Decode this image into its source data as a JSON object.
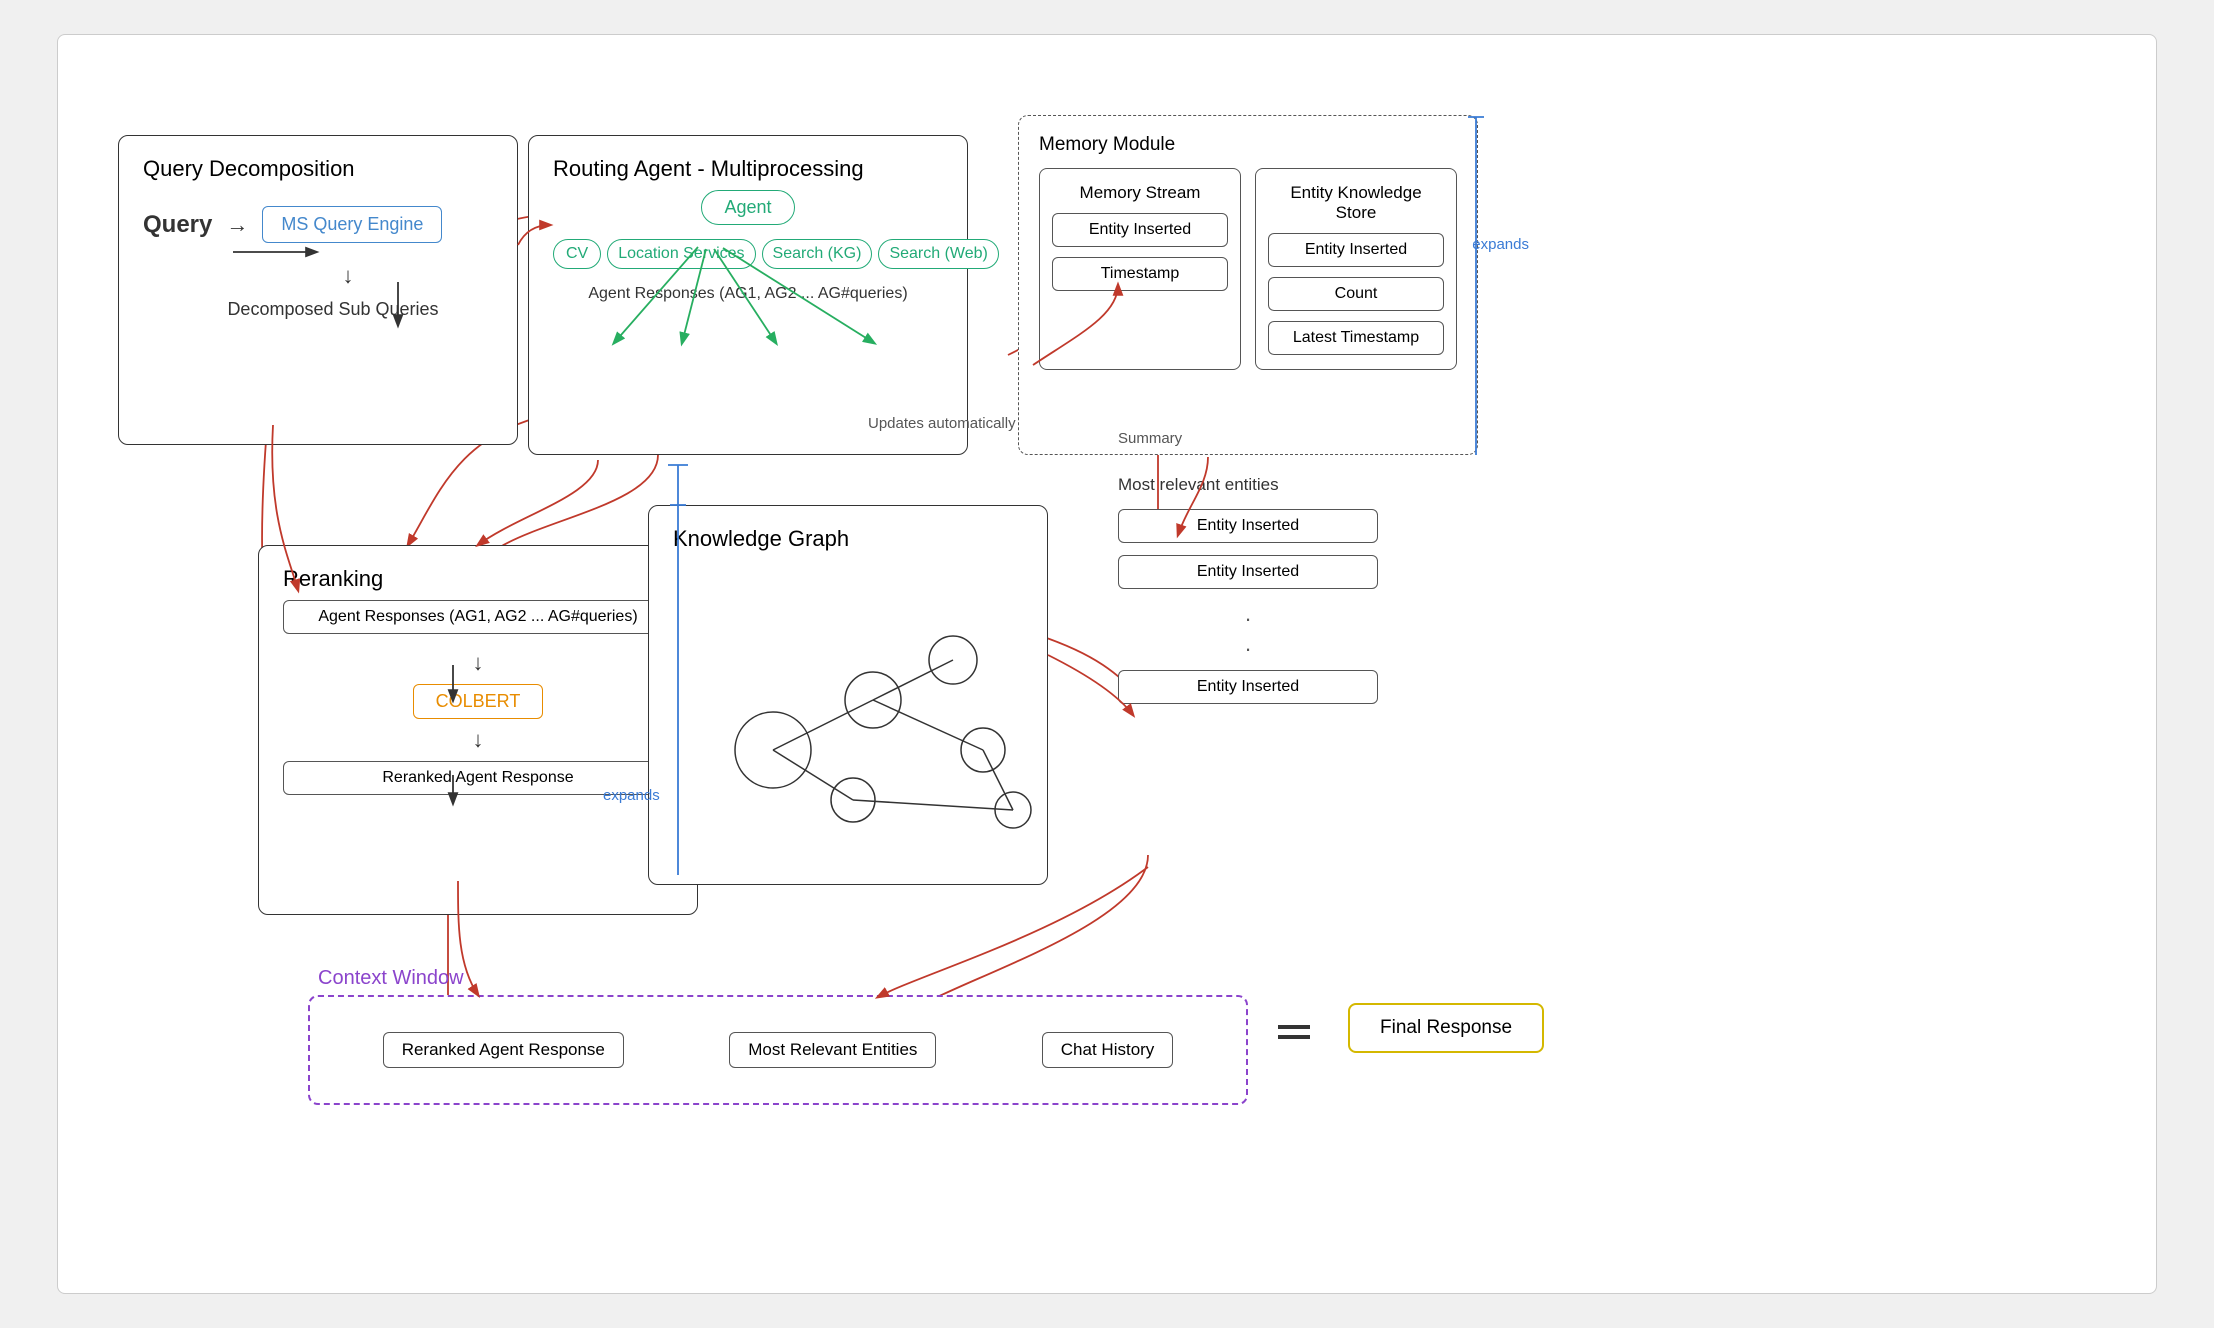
{
  "canvas": {
    "bg": "#ffffff"
  },
  "query_decomp": {
    "title": "Query Decomposition",
    "query_label": "Query",
    "engine_label": "MS Query Engine",
    "subquery_label": "Decomposed Sub Queries"
  },
  "routing_agent": {
    "title": "Routing Agent - Multiprocessing",
    "agent_label": "Agent",
    "cv_label": "CV",
    "location_label": "Location Services",
    "search_kg_label": "Search (KG)",
    "search_web_label": "Search (Web)",
    "responses_label": "Agent Responses (AG1, AG2 ... AG#queries)"
  },
  "memory_module": {
    "title": "Memory Module",
    "stream_title": "Memory Stream",
    "store_title": "Entity Knowledge Store",
    "entity_inserted_1": "Entity Inserted",
    "timestamp_label": "Timestamp",
    "entity_inserted_2": "Entity Inserted",
    "count_label": "Count",
    "latest_timestamp_label": "Latest Timestamp",
    "expands_label": "expands"
  },
  "reranking": {
    "title": "Reranking",
    "responses_label": "Agent Responses (AG1, AG2 ... AG#queries)",
    "colbert_label": "COLBERT",
    "reranked_label": "Reranked Agent Response"
  },
  "knowledge_graph": {
    "title": "Knowledge Graph",
    "expands_label": "expands",
    "updates_label": "Updates automatically",
    "summary_label": "Summary"
  },
  "most_relevant": {
    "title": "Most relevant entities",
    "entity1": "Entity Inserted",
    "entity2": "Entity Inserted",
    "dots": ".",
    "entity3": "Entity Inserted"
  },
  "context_window": {
    "title": "Context Window",
    "reranked_label": "Reranked Agent Response",
    "entities_label": "Most Relevant Entities",
    "chat_label": "Chat History",
    "equals": "=",
    "final_label": "Final Response"
  }
}
